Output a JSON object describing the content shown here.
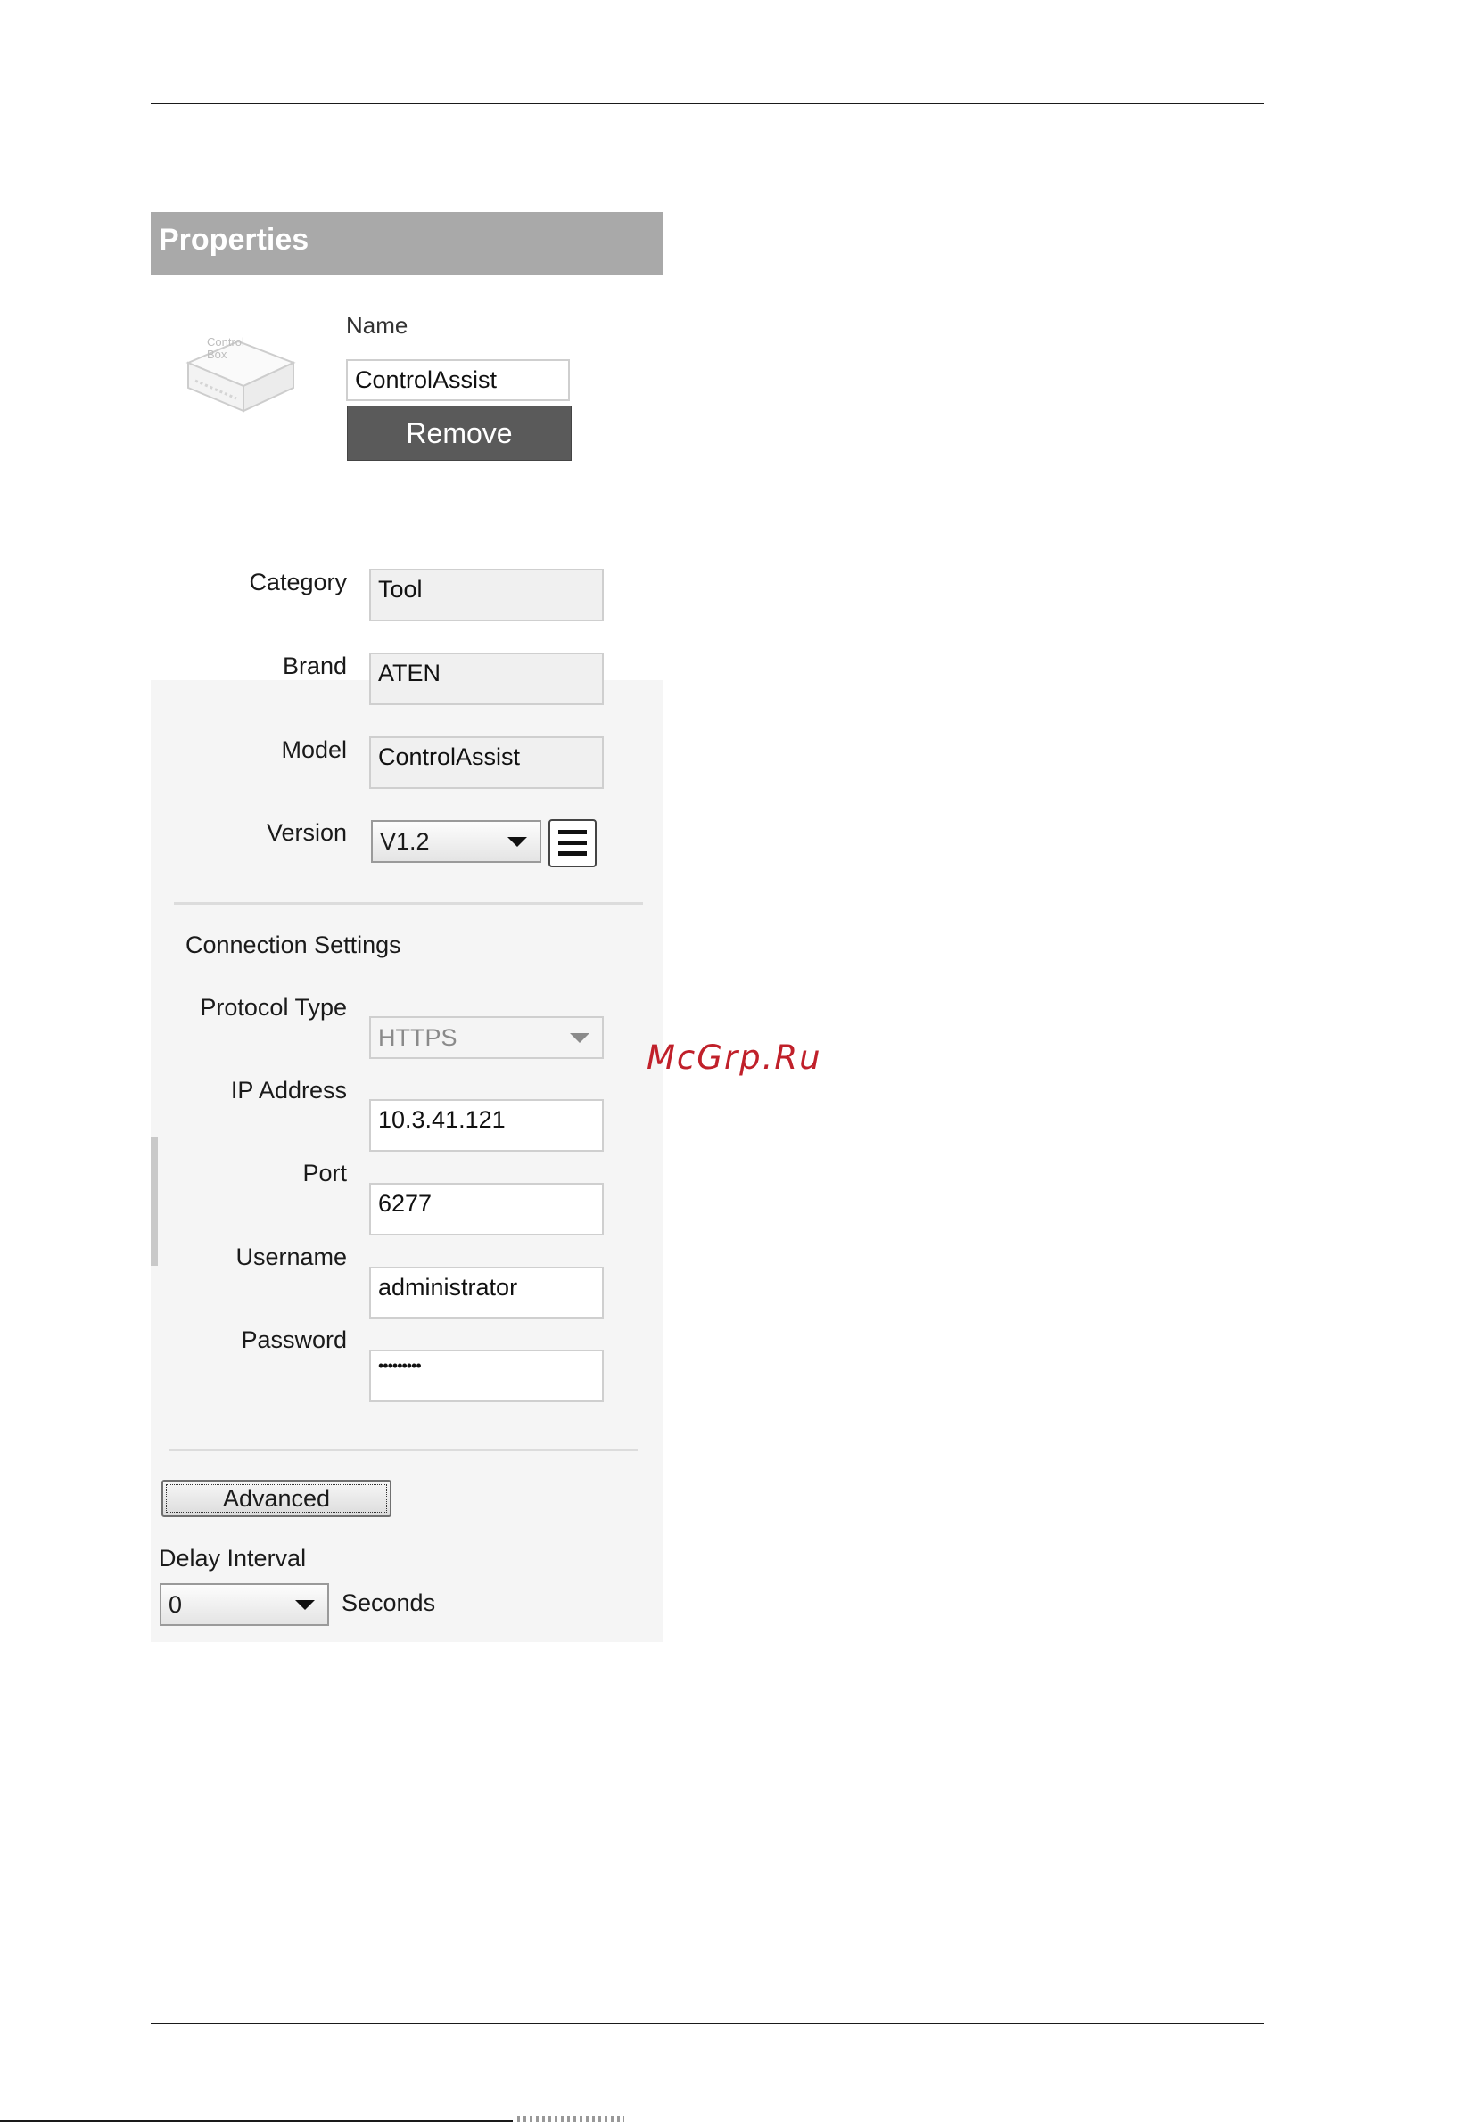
{
  "panel": {
    "title": "Properties",
    "device_icon_text": [
      "Control",
      "Box"
    ],
    "name_label": "Name",
    "name_value": "ControlAssist",
    "remove_label": "Remove"
  },
  "info": {
    "category_label": "Category",
    "category_value": "Tool",
    "brand_label": "Brand",
    "brand_value": "ATEN",
    "model_label": "Model",
    "model_value": "ControlAssist",
    "version_label": "Version",
    "version_value": "V1.2"
  },
  "connection": {
    "heading": "Connection Settings",
    "protocol_label": "Protocol Type",
    "protocol_value": "HTTPS",
    "ip_label": "IP Address",
    "ip_value": "10.3.41.121",
    "port_label": "Port",
    "port_value": "6277",
    "username_label": "Username",
    "username_value": "administrator",
    "password_label": "Password",
    "password_value": "•••••••••"
  },
  "advanced": {
    "button_label": "Advanced",
    "delay_label": "Delay Interval",
    "delay_value": "0",
    "delay_unit": "Seconds"
  },
  "watermark": "McGrp.Ru"
}
